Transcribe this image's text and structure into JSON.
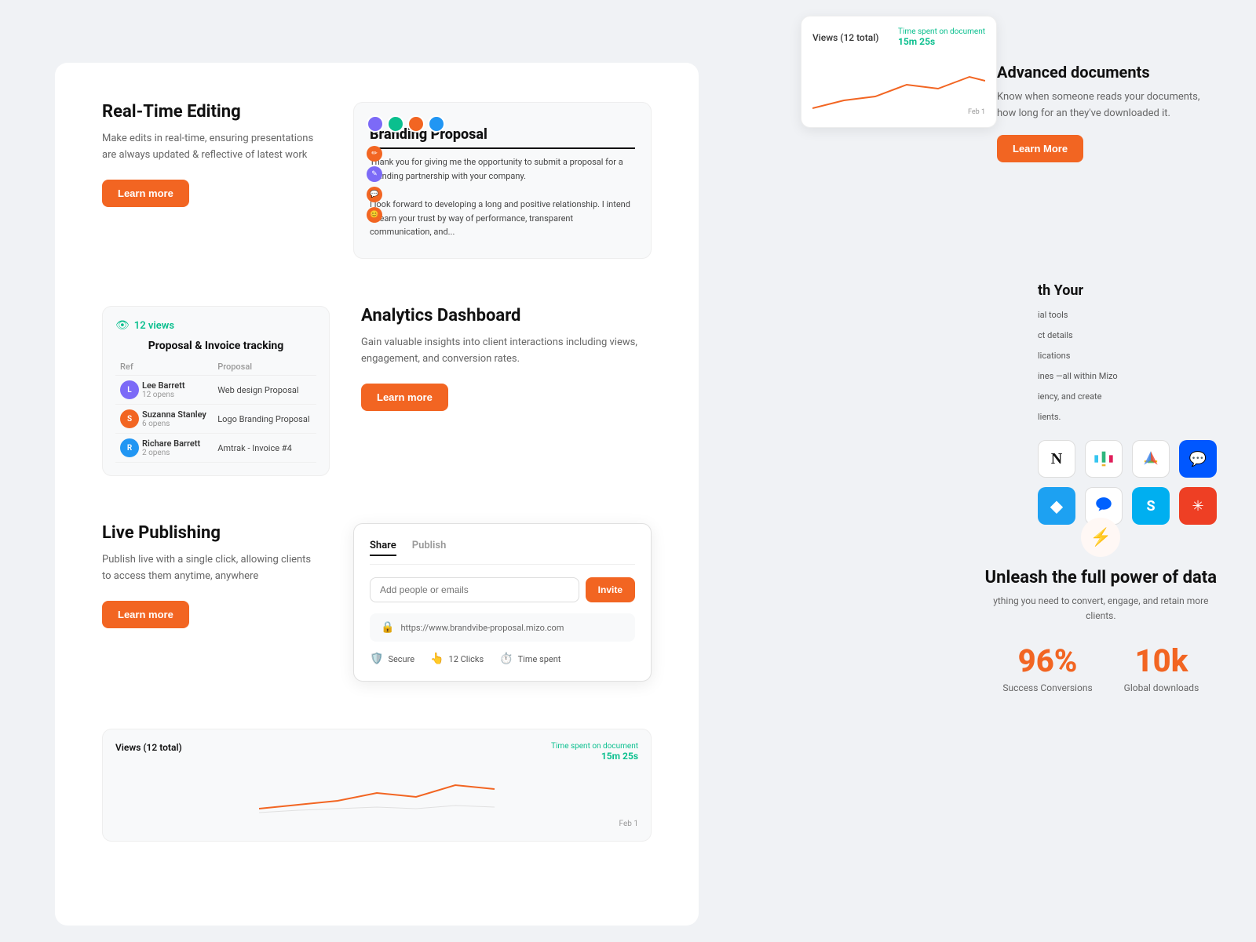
{
  "sections": {
    "realtime": {
      "title": "Real-Time Editing",
      "desc": "Make edits in real-time, ensuring presentations are always updated & reflective of latest work",
      "btn": "Learn more",
      "branding": {
        "title": "Branding Proposal",
        "text1": "Thank you for giving me the opportunity to submit a proposal for a branding partnership with your company.",
        "text2": "I look forward to developing a long and positive relationship. I intend to earn your trust by way of performance, transparent communication, and..."
      }
    },
    "analytics": {
      "title": "Analytics Dashboard",
      "desc": "Gain valuable insights into client interactions including views, engagement, and conversion rates.",
      "btn": "Learn more",
      "proposal": {
        "views": "12 views",
        "title": "Proposal & Invoice tracking",
        "columns": [
          "Ref",
          "Proposal"
        ],
        "rows": [
          {
            "name": "Lee Barrett",
            "opens": "12 opens",
            "proposal": "Web design Proposal",
            "color": "#7c6af7"
          },
          {
            "name": "Suzanna Stanley",
            "opens": "6 opens",
            "proposal": "Logo Branding Proposal",
            "color": "#f26522"
          },
          {
            "name": "Richare Barrett",
            "opens": "2 opens",
            "proposal": "Amtrak - Invoice #4",
            "color": "#2196f3"
          }
        ]
      }
    },
    "publishing": {
      "title": "Live Publishing",
      "desc": "Publish live with a single click, allowing clients to access them anytime, anywhere",
      "btn": "Learn more",
      "modal": {
        "tabs": [
          "Share",
          "Publish"
        ],
        "active_tab": "Share",
        "placeholder": "Add people or emails",
        "invite_btn": "Invite",
        "link": "https://www.brandvibe-proposal.mizo.com",
        "stats": [
          {
            "icon": "🛡️",
            "label": "Secure"
          },
          {
            "icon": "👆",
            "label": "12 Clicks"
          },
          {
            "icon": "⏱️",
            "label": "Time spent"
          }
        ]
      }
    },
    "advanced_docs_bottom": {
      "views": "Views (12 total)",
      "time_label": "Time spent on document",
      "time_value": "15m 25s",
      "title": "Advanced documents"
    }
  },
  "right_panel": {
    "doc_analytics": {
      "views_label": "Views (12 total)",
      "time_label": "Time spent on document",
      "time_value": "15m 25s",
      "date": "Feb 1"
    },
    "advanced_docs": {
      "title": "Advanced documents",
      "desc": "Know when someone reads your documents, how long for an they've downloaded it.",
      "btn": "Learn More"
    },
    "integrations": {
      "heading": "th Your",
      "desc_items": [
        "ial tools",
        "ct details",
        "lications",
        "ines —all within Mizo",
        "iency, and create",
        "lients."
      ],
      "icons": [
        {
          "name": "notion",
          "bg": "#fff",
          "symbol": "N",
          "text_color": "#111",
          "border": "#ddd"
        },
        {
          "name": "slack",
          "bg": "#fff",
          "symbol": "S2",
          "text_color": "#4a154b",
          "border": "#ddd"
        },
        {
          "name": "google-drive",
          "bg": "#fff",
          "symbol": "▲",
          "text_color": "#34a853",
          "border": "#ddd"
        },
        {
          "name": "intercom",
          "bg": "#0057ff",
          "symbol": "💬",
          "text_color": "#fff",
          "border": "none"
        },
        {
          "name": "diamond",
          "bg": "#1da1f2",
          "symbol": "◆",
          "text_color": "#fff",
          "border": "none"
        },
        {
          "name": "dropbox",
          "bg": "#fff",
          "symbol": "❑",
          "text_color": "#0061ff",
          "border": "#ddd"
        },
        {
          "name": "skype",
          "bg": "#00aff0",
          "symbol": "S",
          "text_color": "#fff",
          "border": "none"
        },
        {
          "name": "snowflake",
          "bg": "#ee3f24",
          "symbol": "✳",
          "text_color": "#fff",
          "border": "none"
        }
      ]
    },
    "data_power": {
      "icon": "⚡",
      "title": "Unleash the full power of data",
      "desc": "ything you need to convert, engage, and retain more clients.",
      "stats": [
        {
          "value": "96%",
          "label": "Success Conversions"
        },
        {
          "value": "10k",
          "label": "Global downloads"
        }
      ]
    }
  }
}
